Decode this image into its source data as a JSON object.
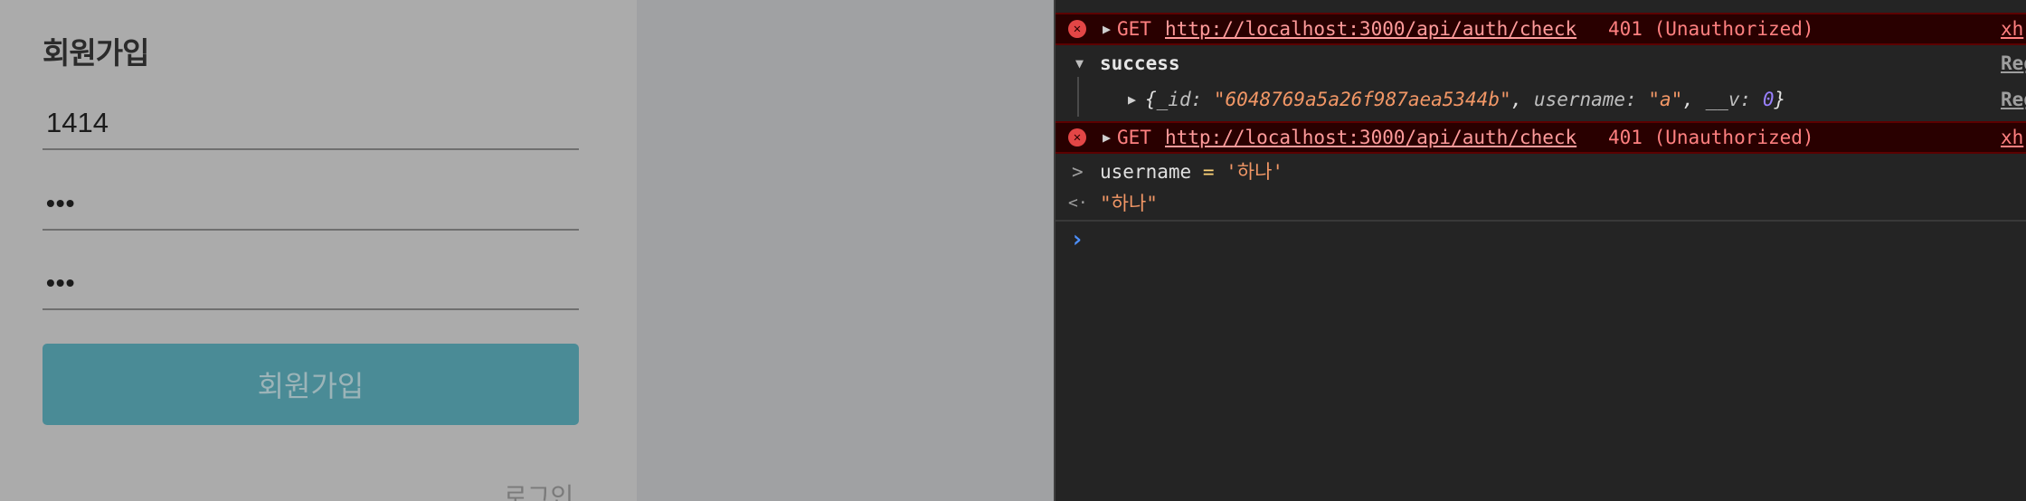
{
  "app": {
    "title": "회원가입",
    "username_value": "1414",
    "password_value": "•••",
    "confirm_value": "•••",
    "submit_label": "회원가입",
    "login_link": "로그인"
  },
  "console": {
    "error_rows": [
      {
        "method": "GET",
        "url": "http://localhost:3000/api/auth/check",
        "status": "401 (Unauthorized)",
        "source": "xh"
      },
      {
        "method": "GET",
        "url": "http://localhost:3000/api/auth/check",
        "status": "401 (Unauthorized)",
        "source": "xh"
      }
    ],
    "group": {
      "label": "success",
      "source": "RegisterFo",
      "object": {
        "open": "{",
        "id_key": "_id",
        "id_value": "\"6048769a5a26f987aea5344b\"",
        "username_key": "username",
        "username_value": "\"a\"",
        "v_key": "__v",
        "v_value": "0",
        "close": "}"
      },
      "object_source": "RegisterFo"
    },
    "input": {
      "variable": "username",
      "operator": "=",
      "value": "'하나'"
    },
    "result": "\"하나\"",
    "prompt_symbol": ">",
    "result_symbol": "<·",
    "caret": "›"
  },
  "colors": {
    "app_background": "#ababab",
    "button": "#4a8b96",
    "console_background": "#242424",
    "error_text": "#ff8080",
    "string": "#f29766",
    "number": "#9980ff"
  }
}
